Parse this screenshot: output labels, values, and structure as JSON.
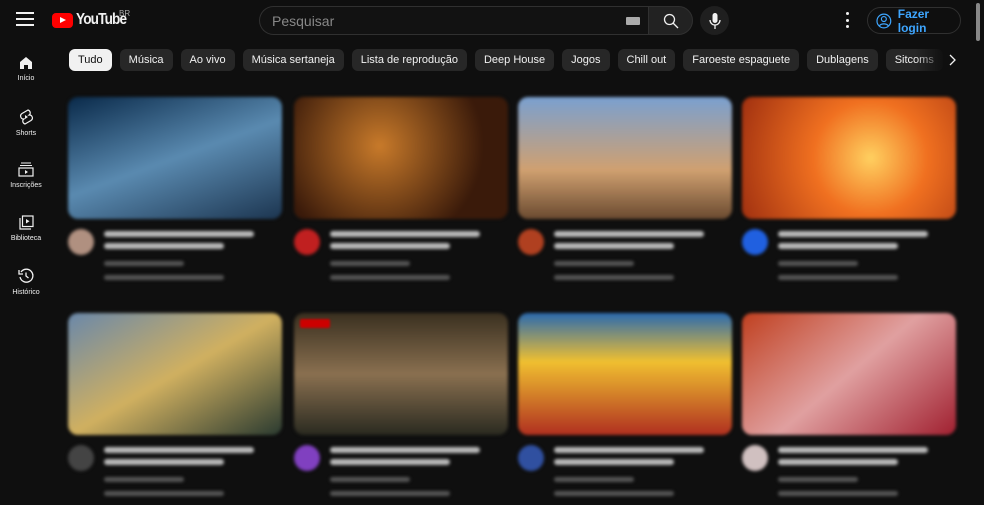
{
  "header": {
    "logo_text": "YouTube",
    "country_code": "BR",
    "search_placeholder": "Pesquisar",
    "login_label": "Fazer login"
  },
  "sidebar": {
    "items": [
      {
        "label": "Início",
        "icon": "home-icon"
      },
      {
        "label": "Shorts",
        "icon": "shorts-icon"
      },
      {
        "label": "Inscrições",
        "icon": "subscriptions-icon"
      },
      {
        "label": "Biblioteca",
        "icon": "library-icon"
      },
      {
        "label": "Histórico",
        "icon": "history-icon"
      }
    ]
  },
  "chips": [
    "Tudo",
    "Música",
    "Ao vivo",
    "Música sertaneja",
    "Lista de reprodução",
    "Deep House",
    "Jogos",
    "Chill out",
    "Faroeste espaguete",
    "Dublagens",
    "Sitcoms"
  ],
  "thumb_colors": [
    "linear-gradient(160deg,#0a2a4a,#5a8ab0 50%,#1c3550)",
    "radial-gradient(circle at 40% 40%,#c87a2a,#3a1a0a 70%)",
    "linear-gradient(180deg,#7aa0d0,#d0a070 60%,#6a4a30)",
    "radial-gradient(circle at 60% 50%,#ffd060,#f07020 40%,#a03010)",
    "linear-gradient(150deg,#6a88aa,#d0b060 50%,#2a3a30)",
    "linear-gradient(180deg,#3a3020,#8a7050 50%,#2a2a20)",
    "linear-gradient(180deg,#2a6ab0,#f0c030 40%,#b03020)",
    "linear-gradient(140deg,#c04020,#e0a0a0 50%,#a02030)"
  ],
  "avatar_colors": [
    "#b09080",
    "#c02020",
    "#b04020",
    "#2060e0",
    "#444",
    "#8040c0",
    "#3050a0",
    "#d0c0c0"
  ]
}
